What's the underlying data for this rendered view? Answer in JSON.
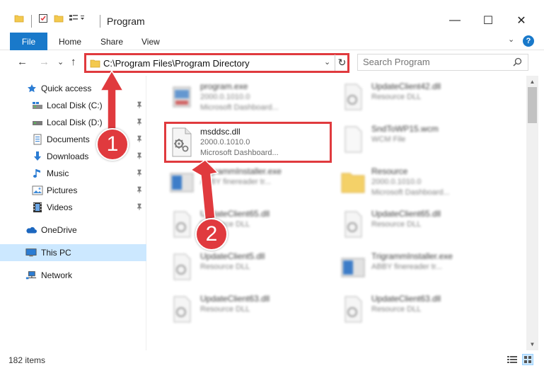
{
  "window": {
    "title": "Program",
    "minimize_glyph": "—",
    "maximize_glyph": "☐",
    "close_glyph": "✕"
  },
  "ribbon": {
    "tabs": [
      "File",
      "Home",
      "Share",
      "View"
    ],
    "help_label": "?",
    "collapse_glyph": "⌄"
  },
  "nav": {
    "back_glyph": "←",
    "forward_glyph": "→",
    "recent_glyph": "⌄",
    "up_glyph": "↑",
    "address": "C:\\Program Files\\Program Directory",
    "address_dropdown_glyph": "⌄",
    "refresh_glyph": "↻",
    "search_placeholder": "Search Program"
  },
  "sidebar": {
    "items": [
      {
        "label": "Quick access",
        "icon": "star-icon",
        "pinned": false
      },
      {
        "label": "Local Disk (C:)",
        "icon": "drive-icon",
        "pinned": true
      },
      {
        "label": "Local Disk (D:)",
        "icon": "drive-icon",
        "pinned": true
      },
      {
        "label": "Documents",
        "icon": "documents-icon",
        "pinned": true
      },
      {
        "label": "Downloads",
        "icon": "download-icon",
        "pinned": true
      },
      {
        "label": "Music",
        "icon": "music-icon",
        "pinned": true
      },
      {
        "label": "Pictures",
        "icon": "pictures-icon",
        "pinned": true
      },
      {
        "label": "Videos",
        "icon": "videos-icon",
        "pinned": true
      },
      {
        "label": "OneDrive",
        "icon": "cloud-icon",
        "pinned": false
      },
      {
        "label": "This PC",
        "icon": "computer-icon",
        "pinned": false,
        "selected": true
      },
      {
        "label": "Network",
        "icon": "network-icon",
        "pinned": false
      }
    ],
    "pin_glyph": "📌"
  },
  "files": [
    {
      "name": "program.exe",
      "version": "2000.0.1010.0",
      "desc": "Microsoft Dashboard...",
      "icon": "exe-icon"
    },
    {
      "name": "UpdateClient42.dll",
      "version": "Resource DLL",
      "desc": "",
      "icon": "dll-icon"
    },
    {
      "name": "msddsc.dll",
      "version": "2000.0.1010.0",
      "desc": "Microsoft Dashboard...",
      "icon": "dll-gear-icon",
      "highlighted": true
    },
    {
      "name": "SndToWP15.wcm",
      "version": "WCM File",
      "desc": "",
      "icon": "file-icon"
    },
    {
      "name": "TrigrammInstaller.exe",
      "version": "ABBY finereader tr...",
      "desc": "",
      "icon": "installer-icon"
    },
    {
      "name": "Resource",
      "version": "2000.0.1010.0",
      "desc": "Microsoft Dashboard...",
      "icon": "folder-icon"
    },
    {
      "name": "UpdateClient65.dll",
      "version": "Resource DLL",
      "desc": "",
      "icon": "dll-icon"
    },
    {
      "name": "UpdateClient65.dll",
      "version": "Resource DLL",
      "desc": "",
      "icon": "dll-icon"
    },
    {
      "name": "UpdateClient5.dll",
      "version": "Resource DLL",
      "desc": "",
      "icon": "dll-icon"
    },
    {
      "name": "TrigrammInstaller.exe",
      "version": "ABBY finereader tr...",
      "desc": "",
      "icon": "installer-icon"
    },
    {
      "name": "UpdateClient63.dll",
      "version": "Resource DLL",
      "desc": "",
      "icon": "dll-icon"
    },
    {
      "name": "UpdateClient63.dll",
      "version": "Resource DLL",
      "desc": "",
      "icon": "dll-icon"
    }
  ],
  "status": {
    "item_count": "182 items"
  },
  "callouts": {
    "one": "1",
    "two": "2"
  },
  "colors": {
    "accent": "#1979ca",
    "callout_red": "#e03a3e",
    "selected": "#cce8ff"
  }
}
